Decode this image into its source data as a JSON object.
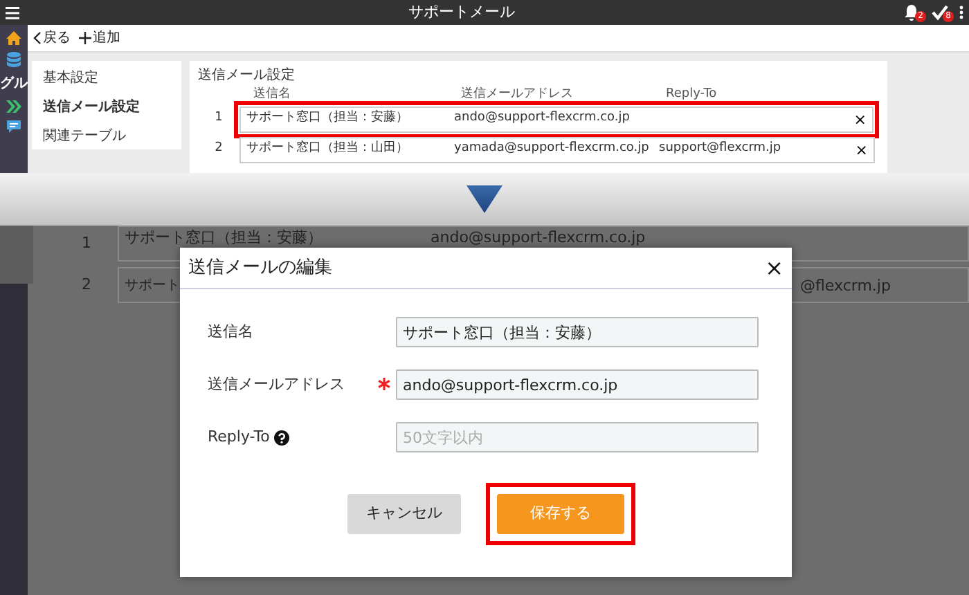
{
  "app": {
    "title": "サポートメール",
    "notifications": [
      {
        "kind": "bell",
        "count": "2"
      },
      {
        "kind": "check",
        "count": "8"
      }
    ]
  },
  "rail": [
    {
      "kind": "home"
    },
    {
      "kind": "database"
    },
    {
      "kind": "text",
      "label": "グル"
    },
    {
      "kind": "arrows"
    },
    {
      "kind": "chat"
    }
  ],
  "toolbar": {
    "back": "戻る",
    "add": "追加"
  },
  "settings_nav": [
    {
      "label": "基本設定",
      "selected": false
    },
    {
      "label": "送信メール設定",
      "selected": true
    },
    {
      "label": "関連テーブル",
      "selected": false
    }
  ],
  "panel": {
    "title": "送信メール設定",
    "columns": [
      "送信名",
      "送信メールアドレス",
      "Reply-To"
    ],
    "rows": [
      {
        "index": "1",
        "name": "サポート窓口（担当：安藤）",
        "address": "ando@support-flexcrm.co.jp",
        "reply_to": "",
        "remove": "×",
        "highlighted": true
      },
      {
        "index": "2",
        "name": "サポート窓口（担当：山田）",
        "address": "yamada@support-flexcrm.co.jp",
        "reply_to": "support@flexcrm.jp",
        "remove": "×",
        "highlighted": false
      }
    ]
  },
  "background_rows": [
    {
      "index": "1",
      "name": "サポート窓口（担当：安藤）",
      "address": "ando@support-flexcrm.co.jp"
    },
    {
      "index": "2",
      "name": "サポート",
      "address": "@flexcrm.jp"
    }
  ],
  "dialog": {
    "title": "送信メールの編集",
    "close": "×",
    "fields": [
      {
        "label": "送信名",
        "value": "サポート窓口（担当：安藤）",
        "required": false,
        "help": false
      },
      {
        "label": "送信メールアドレス",
        "value": "ando@support-flexcrm.co.jp",
        "required": true,
        "help": false
      },
      {
        "label": "Reply-To",
        "placeholder": "50文字以内",
        "required": false,
        "help": true
      }
    ],
    "buttons": [
      {
        "label": "キャンセル",
        "kind": "secondary",
        "highlighted": false
      },
      {
        "label": "保存する",
        "kind": "primary",
        "highlighted": true
      }
    ]
  }
}
